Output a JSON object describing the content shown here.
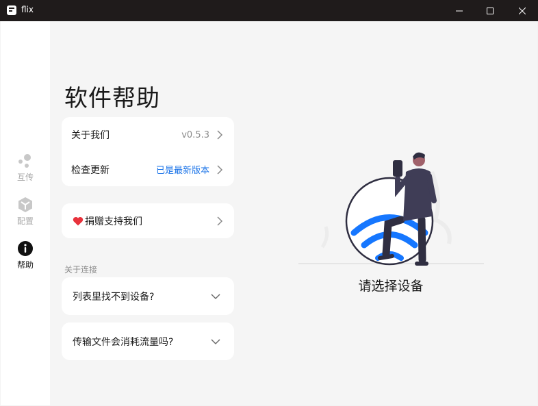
{
  "window": {
    "title": "flix",
    "minimize_icon": "minimize-icon",
    "maximize_icon": "maximize-icon",
    "close_icon": "close-icon"
  },
  "sidebar": {
    "items": [
      {
        "label": "互传",
        "icon": "transfer-dots-icon",
        "active": false
      },
      {
        "label": "配置",
        "icon": "cube-icon",
        "active": false
      },
      {
        "label": "帮助",
        "icon": "info-icon",
        "active": true
      }
    ]
  },
  "help": {
    "title": "软件帮助",
    "about": {
      "label": "关于我们",
      "value": "v0.5.3"
    },
    "update": {
      "label": "检查更新",
      "value": "已是最新版本"
    },
    "donate": {
      "label": "捐赠支持我们",
      "icon": "heart-icon"
    },
    "section_label": "关于连接",
    "faq": [
      {
        "label": "列表里找不到设备?"
      },
      {
        "label": "传输文件会消耗流量吗?"
      }
    ]
  },
  "main": {
    "status": "请选择设备"
  },
  "colors": {
    "accent": "#1a73e8",
    "wifi": "#1677ff",
    "titlebar": "#1f1b1b",
    "heart": "#e8323c"
  }
}
